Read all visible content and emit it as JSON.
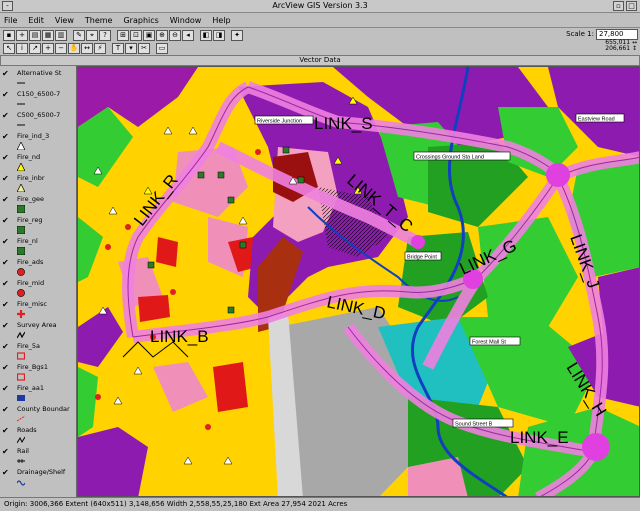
{
  "window": {
    "title": "ArcView GIS Version 3.3"
  },
  "menu": [
    "File",
    "Edit",
    "View",
    "Theme",
    "Graphics",
    "Window",
    "Help"
  ],
  "toolbar": {
    "scale_label": "Scale 1:",
    "scale_value": "27,800",
    "coords_top": "655,011 ↔",
    "coords_bottom": "206,661 ↕"
  },
  "view": {
    "title": "Vector Data"
  },
  "legend": [
    {
      "label": "Alternative St",
      "symbol": "line",
      "color": "#444444"
    },
    {
      "label": "C150_6500-7",
      "symbol": "line",
      "color": "#444444"
    },
    {
      "label": "C500_6500-7",
      "symbol": "line",
      "color": "#444444"
    },
    {
      "label": "Fire_ind_3",
      "symbol": "tri",
      "color": "#ffffff"
    },
    {
      "label": "Fire_nd",
      "symbol": "tri",
      "color": "#ffff00"
    },
    {
      "label": "Fire_inbr",
      "symbol": "tri",
      "color": "#f0f0a0"
    },
    {
      "label": "Fire_gee",
      "symbol": "square",
      "color": "#2a7a2a"
    },
    {
      "label": "Fire_reg",
      "symbol": "square",
      "color": "#2a7a2a"
    },
    {
      "label": "Fire_nl",
      "symbol": "square",
      "color": "#2a7a2a"
    },
    {
      "label": "Fire_ads",
      "symbol": "circle",
      "color": "#e02020"
    },
    {
      "label": "Fire_mid",
      "symbol": "circle",
      "color": "#e02020"
    },
    {
      "label": "Fire_misc",
      "symbol": "cross",
      "color": "#e02020"
    },
    {
      "label": "Survey Area",
      "symbol": "zigzag",
      "color": "#000000"
    },
    {
      "label": "Fire_5a",
      "symbol": "box",
      "color": "#e02020"
    },
    {
      "label": "Fire_Bgs1",
      "symbol": "box",
      "color": "#e02020"
    },
    {
      "label": "Fire_aa1",
      "symbol": "fillbox",
      "color": "#1e3aa0"
    },
    {
      "label": "County Boundar",
      "symbol": "dash",
      "color": "#e02020"
    },
    {
      "label": "Roads",
      "symbol": "roads",
      "color": "#e02020"
    },
    {
      "label": "Rail",
      "symbol": "rail",
      "color": "#000000"
    },
    {
      "label": "Drainage/Shelf",
      "symbol": "wave",
      "color": "#1e3aa0"
    }
  ],
  "map_labels": [
    {
      "text": "LINK_S",
      "kind": "link"
    },
    {
      "text": "LINK_R",
      "kind": "link"
    },
    {
      "text": "LINK_T_C",
      "kind": "link"
    },
    {
      "text": "LINK_G",
      "kind": "link"
    },
    {
      "text": "LINK_J",
      "kind": "link"
    },
    {
      "text": "LINK_D",
      "kind": "link"
    },
    {
      "text": "LINK_B",
      "kind": "link"
    },
    {
      "text": "LINK_H",
      "kind": "link"
    },
    {
      "text": "LINK_E",
      "kind": "link"
    },
    {
      "text": "Riverside Junction",
      "kind": "box"
    },
    {
      "text": "Eastview Road",
      "kind": "box"
    },
    {
      "text": "Crossings Ground Sta Land",
      "kind": "box"
    },
    {
      "text": "Bridge Point",
      "kind": "box"
    },
    {
      "text": "Forest Mall St",
      "kind": "box"
    },
    {
      "text": "Sound Street B",
      "kind": "box"
    }
  ],
  "status": {
    "text": "Origin: 3006,366  Extent (640x511) 3,148,656  Width 2,558,55,25,180  Ext Area 27,954  2021 Acres"
  },
  "colors": {
    "yellow": "#ffd200",
    "green": "#33cc33",
    "purple": "#8e1bb0",
    "pink": "#f080b0",
    "road": "#e060d0",
    "water": "#1040c0"
  }
}
